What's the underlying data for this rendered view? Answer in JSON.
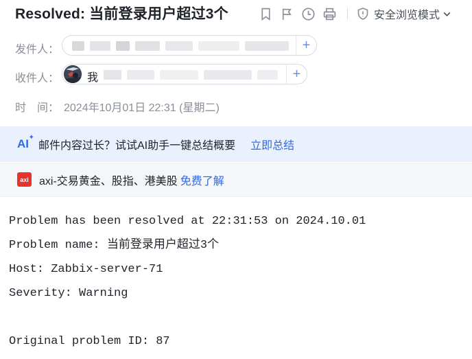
{
  "subject": "Resolved: 当前登录用户超过3个",
  "toolbar": {
    "safe_mode_label": "安全浏览模式",
    "icons": [
      "bookmark-icon",
      "flag-icon",
      "clock-icon",
      "print-icon",
      "shield-icon",
      "chevron-down-icon"
    ]
  },
  "from": {
    "label": "发件人："
  },
  "to": {
    "label": "收件人：",
    "me_label": "我"
  },
  "date": {
    "label": "时　间：",
    "value": "2024年10月01日 22:31 (星期二)"
  },
  "ai_banner": {
    "logo": "AI",
    "text": "邮件内容过长？试试AI助手一键总结概要",
    "link": "立即总结"
  },
  "ad_banner": {
    "logo": "axi",
    "text": "axi-交易黄金、股指、港美股",
    "link": "免费了解"
  },
  "body": {
    "lines": [
      "Problem has been resolved at 22:31:53 on 2024.10.01",
      "Problem name: 当前登录用户超过3个",
      "Host: Zabbix-server-71",
      "Severity: Warning",
      "",
      "Original problem ID: 87"
    ]
  },
  "colors": {
    "link": "#2e6ae6",
    "ai_banner_bg": "#eaf1fd",
    "ad_banner_bg": "#f5f6f8",
    "ad_logo": "#e8322e"
  }
}
